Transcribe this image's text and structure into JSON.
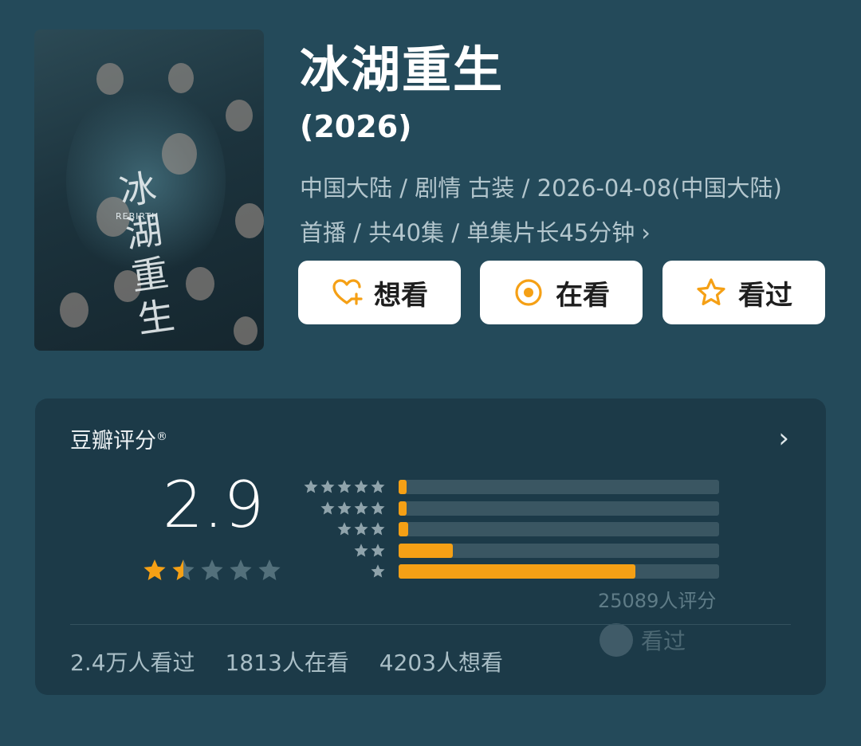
{
  "header": {
    "title": "冰湖重生",
    "year": "(2026)",
    "meta_line1": "中国大陆 / 剧情 古装 / 2026-04-08(中国大陆)",
    "meta_line2": "首播 / 共40集 / 单集片长45分钟",
    "meta_chevron": "›"
  },
  "poster": {
    "calligraphy": "冰湖重生",
    "subtitle": "REBIRTH"
  },
  "actions": {
    "want_label": "想看",
    "watching_label": "在看",
    "watched_label": "看过",
    "accent_color": "#f5a015"
  },
  "rating": {
    "title": "豆瓣评分",
    "registered": "®",
    "chevron": "›",
    "score": "2.9",
    "score_value": 2.9,
    "score_stars_filled": 1.5,
    "distribution": [
      {
        "stars": 5,
        "fraction": 0.02
      },
      {
        "stars": 4,
        "fraction": 0.02
      },
      {
        "stars": 3,
        "fraction": 0.03
      },
      {
        "stars": 2,
        "fraction": 0.17
      },
      {
        "stars": 1,
        "fraction": 0.74
      }
    ],
    "raters": "25089人评分",
    "watched_count": "2.4万人看过",
    "watching_count": "1813人在看",
    "want_count": "4203人想看",
    "watermark": "看过"
  }
}
